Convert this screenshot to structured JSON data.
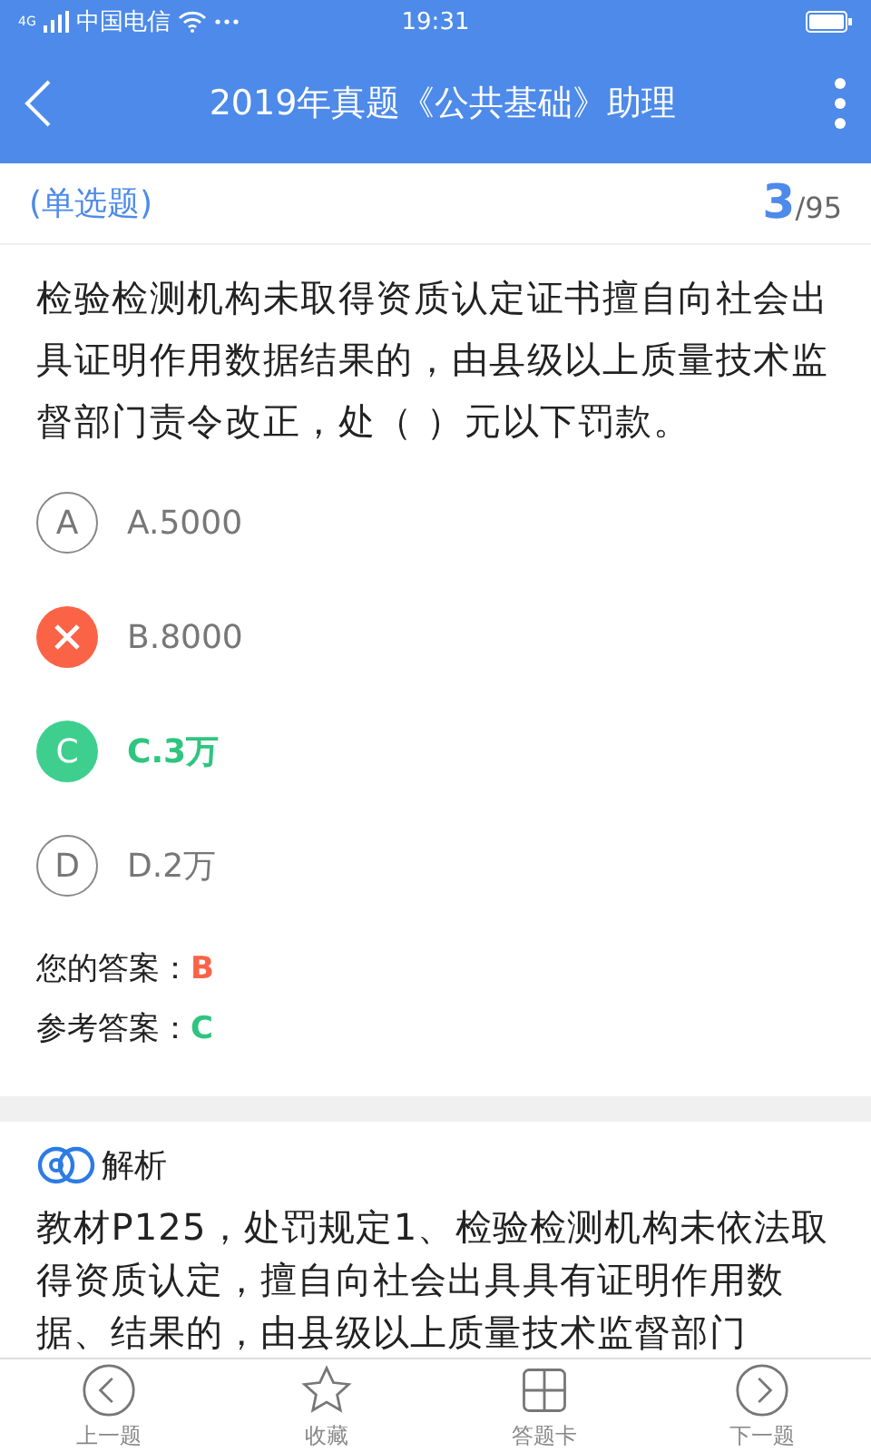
{
  "status_bar": {
    "signal": "4G",
    "carrier": "中国电信",
    "time": "19:31"
  },
  "header": {
    "title": "2019年真题《公共基础》助理"
  },
  "question": {
    "type": "(单选题)",
    "index": "3",
    "total": "/95",
    "text": "检验检测机构未取得资质认定证书擅自向社会出具证明作用数据结果的，由县级以上质量技术监督部门责令改正，处（ ）元以下罚款。"
  },
  "options": [
    {
      "letter": "A",
      "text": "A.5000",
      "kind": "normal"
    },
    {
      "text": "B.8000",
      "kind": "wrong"
    },
    {
      "letter": "C",
      "text": "C.3万",
      "kind": "correct"
    },
    {
      "letter": "D",
      "text": "D.2万",
      "kind": "normal"
    }
  ],
  "answers": [
    {
      "label": "您的答案：",
      "value": "B",
      "kind": "wrong"
    },
    {
      "label": "参考答案：",
      "value": "C",
      "kind": "correct"
    }
  ],
  "analysis": {
    "title": "解析",
    "text": "教材P125，处罚规定1、检验检测机构未依法取得资质认定，擅自向社会出具具有证明作用数据、结果的，由县级以上质量技术监督部门"
  },
  "bottom_bar": [
    {
      "label": "上一题",
      "kind": "prev"
    },
    {
      "label": "收藏",
      "kind": "star"
    },
    {
      "label": "答题卡",
      "kind": "card"
    },
    {
      "label": "下一题",
      "kind": "next"
    }
  ]
}
